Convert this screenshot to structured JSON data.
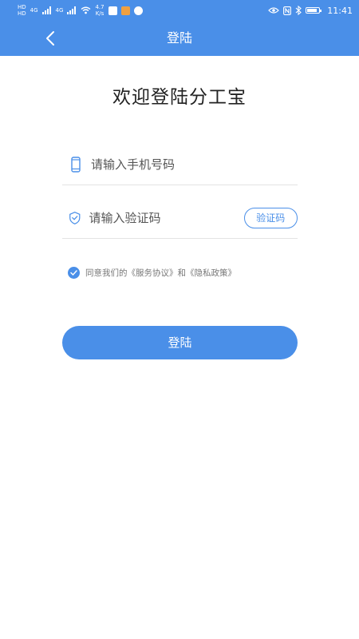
{
  "status_bar": {
    "sim1": "HD",
    "sim2": "HD",
    "net1": "4G",
    "net2": "4G",
    "speed_value": "4.7",
    "speed_unit": "K/s",
    "time": "11:41",
    "battery_level": 0.85,
    "icons": [
      "signal-icon",
      "wifi-icon",
      "eye-icon",
      "nfc-icon",
      "bluetooth-icon",
      "battery-icon"
    ]
  },
  "nav": {
    "title": "登陆",
    "back_icon": "chevron-left-icon"
  },
  "welcome": "欢迎登陆分工宝",
  "phone_field": {
    "placeholder": "请输入手机号码",
    "value": "",
    "icon": "phone-icon"
  },
  "code_field": {
    "placeholder": "请输入验证码",
    "value": "",
    "icon": "shield-icon",
    "button_label": "验证码"
  },
  "agreement": {
    "checked": true,
    "prefix": "同意我们的",
    "service_link": "《服务协议》",
    "and": "和",
    "privacy_link": "《隐私政策》"
  },
  "login_button": "登陆",
  "colors": {
    "primary": "#4a8fe8",
    "divider": "#e3e3e3",
    "text": "#222222"
  }
}
